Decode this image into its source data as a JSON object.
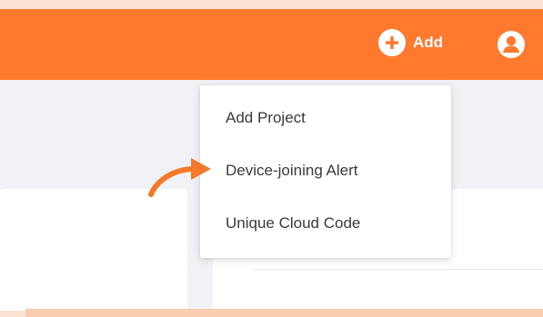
{
  "header": {
    "add_label": "Add",
    "accent_color": "#ff7a2f",
    "add_icon": "plus-circle-icon",
    "avatar_icon": "user-icon"
  },
  "dropdown": {
    "items": [
      {
        "label": "Add Project"
      },
      {
        "label": "Device-joining Alert"
      },
      {
        "label": "Unique Cloud Code"
      }
    ]
  },
  "annotation": {
    "arrow_icon": "curved-arrow-icon",
    "arrow_color": "#f5792a"
  }
}
